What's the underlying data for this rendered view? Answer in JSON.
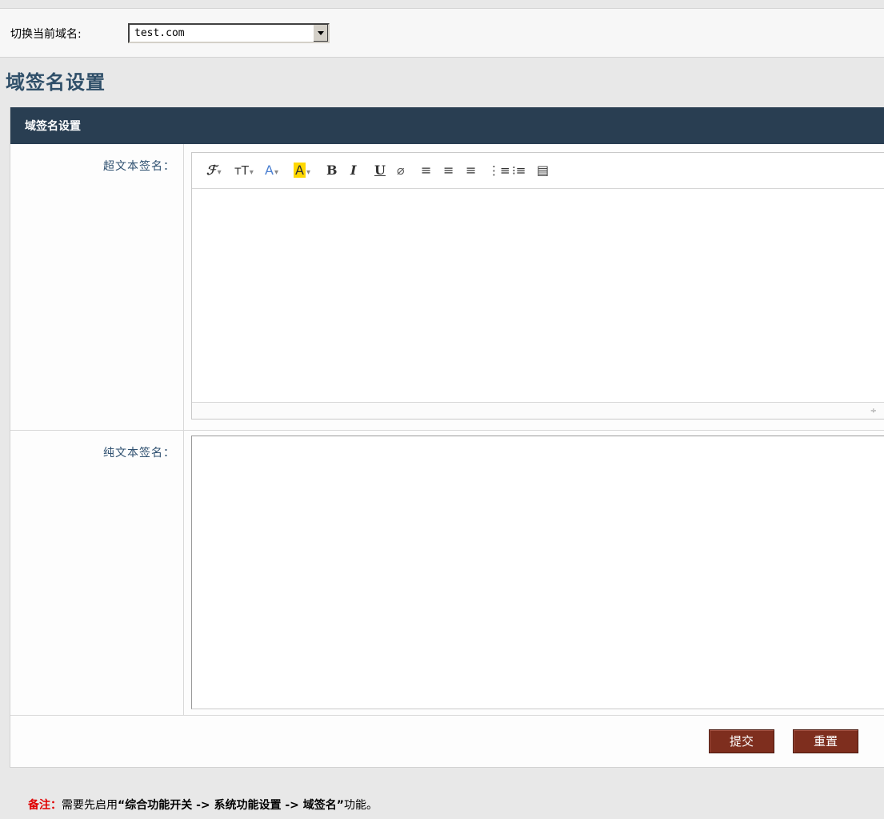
{
  "domain_switch": {
    "label": "切换当前域名:",
    "selected": "test.com"
  },
  "page": {
    "title": "域签名设置"
  },
  "panel": {
    "title": "域签名设置",
    "rich_label": "超文本签名：",
    "plain_label": "纯文本签名：",
    "rich_value": "",
    "plain_value": ""
  },
  "toolbar": {
    "icons": [
      "font-family-icon",
      "font-size-icon",
      "font-color-icon",
      "highlight-color-icon",
      "bold-icon",
      "italic-icon",
      "underline-icon",
      "eraser-icon",
      "align-left-icon",
      "align-center-icon",
      "align-right-icon",
      "ordered-list-icon",
      "unordered-list-icon",
      "paste-icon"
    ]
  },
  "actions": {
    "submit": "提交",
    "reset": "重置"
  },
  "note": {
    "key": "备注：",
    "before": "需要先启用",
    "path": "“综合功能开关 -> 系统功能设置 -> 域签名”",
    "after": "功能。"
  },
  "colors": {
    "header_bg": "#293e52",
    "title": "#2f4f69",
    "button_bg": "#7e2e1e",
    "note_key": "#e00000",
    "highlight": "#ffd800"
  }
}
